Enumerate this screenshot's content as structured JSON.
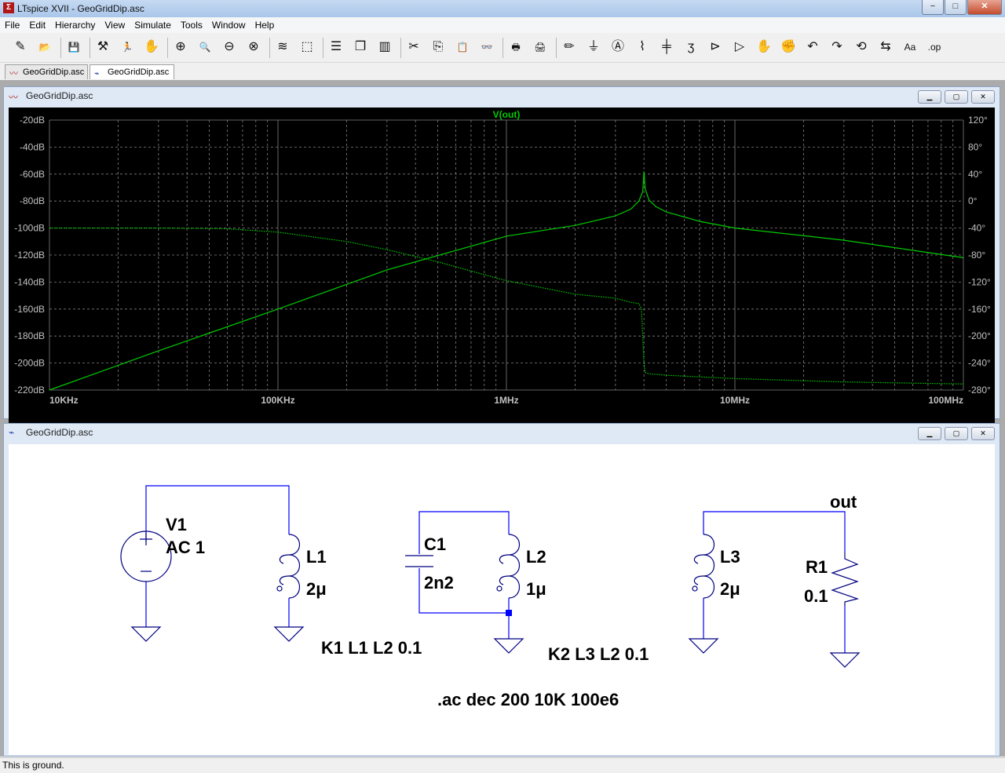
{
  "window": {
    "title": "LTspice XVII - GeoGridDip.asc",
    "min": "−",
    "max": "□",
    "close": "✕"
  },
  "menu": [
    "File",
    "Edit",
    "Hierarchy",
    "View",
    "Simulate",
    "Tools",
    "Window",
    "Help"
  ],
  "toolbar_icons": [
    {
      "name": "new-schematic-icon",
      "glyph": "✎"
    },
    {
      "name": "open-icon",
      "glyph": "📂"
    },
    {
      "name": "save-icon",
      "glyph": "💾"
    },
    {
      "name": "control-panel-icon",
      "glyph": "⚒"
    },
    {
      "name": "run-icon",
      "glyph": "🏃"
    },
    {
      "name": "halt-icon",
      "glyph": "✋"
    },
    {
      "name": "zoom-in-icon",
      "glyph": "⊕"
    },
    {
      "name": "pan-icon",
      "glyph": "🔍"
    },
    {
      "name": "zoom-out-icon",
      "glyph": "⊖"
    },
    {
      "name": "zoom-cancel-icon",
      "glyph": "⊗"
    },
    {
      "name": "autorange-icon",
      "glyph": "≋"
    },
    {
      "name": "fit-icon",
      "glyph": "⬚"
    },
    {
      "name": "tile-horizontal-icon",
      "glyph": "☰"
    },
    {
      "name": "cascade-icon",
      "glyph": "❐"
    },
    {
      "name": "tile-vertical-icon",
      "glyph": "▥"
    },
    {
      "name": "cut-icon",
      "glyph": "✂"
    },
    {
      "name": "copy-icon",
      "glyph": "⎘"
    },
    {
      "name": "paste-icon",
      "glyph": "📋"
    },
    {
      "name": "find-icon",
      "glyph": "👓"
    },
    {
      "name": "print-icon",
      "glyph": "🖶"
    },
    {
      "name": "print-setup-icon",
      "glyph": "🖨"
    },
    {
      "name": "draw-wire-icon",
      "glyph": "✏"
    },
    {
      "name": "ground-icon",
      "glyph": "⏚"
    },
    {
      "name": "label-net-icon",
      "glyph": "Ⓐ"
    },
    {
      "name": "resistor-icon",
      "glyph": "⌇"
    },
    {
      "name": "capacitor-icon",
      "glyph": "╪"
    },
    {
      "name": "inductor-icon",
      "glyph": "ʒ"
    },
    {
      "name": "diode-icon",
      "glyph": "⊳"
    },
    {
      "name": "component-icon",
      "glyph": "▷"
    },
    {
      "name": "move-icon",
      "glyph": "✋"
    },
    {
      "name": "drag-icon",
      "glyph": "✊"
    },
    {
      "name": "undo-icon",
      "glyph": "↶"
    },
    {
      "name": "redo-icon",
      "glyph": "↷"
    },
    {
      "name": "rotate-icon",
      "glyph": "⟲"
    },
    {
      "name": "mirror-icon",
      "glyph": "⇆"
    },
    {
      "name": "text-icon",
      "glyph": "Aa"
    },
    {
      "name": "spice-directive-icon",
      "glyph": ".op"
    }
  ],
  "doc_tabs": [
    {
      "label": "GeoGridDip.asc",
      "icon": "waveform-icon",
      "active": false
    },
    {
      "label": "GeoGridDip.asc",
      "icon": "schematic-icon",
      "active": true
    }
  ],
  "waveform_window": {
    "title": "GeoGridDip.asc"
  },
  "schematic_window": {
    "title": "GeoGridDip.asc"
  },
  "chart_data": {
    "type": "line",
    "title": "V(out)",
    "x_scale": "log",
    "x_ticks": [
      "10KHz",
      "100KHz",
      "1MHz",
      "10MHz",
      "100MHz"
    ],
    "x_range": [
      10000,
      100000000
    ],
    "y_left_ticks": [
      "-20dB",
      "-40dB",
      "-60dB",
      "-80dB",
      "-100dB",
      "-120dB",
      "-140dB",
      "-160dB",
      "-180dB",
      "-200dB",
      "-220dB"
    ],
    "y_left_range": [
      -220,
      -20
    ],
    "y_right_ticks": [
      "120°",
      "80°",
      "40°",
      "0°",
      "-40°",
      "-80°",
      "-120°",
      "-160°",
      "-200°",
      "-240°",
      "-280°"
    ],
    "y_right_range": [
      -280,
      120
    ],
    "grid": true,
    "colors": {
      "background": "#000000",
      "trace": "#00cc00",
      "grid": "#808080",
      "axis_text": "#c0c0c0"
    },
    "series": [
      {
        "name": "V(out)",
        "style": "solid",
        "unit": "dB",
        "x": [
          10000,
          30000,
          100000,
          300000,
          1000000,
          2000000,
          3000000,
          3500000,
          3800000,
          3950000,
          4000000,
          4050000,
          4200000,
          4500000,
          5000000,
          7000000,
          10000000,
          30000000,
          100000000
        ],
        "y": [
          -220,
          -191,
          -160,
          -131,
          -106,
          -98,
          -91,
          -86,
          -80,
          -73,
          -58,
          -71,
          -79,
          -84,
          -88,
          -95,
          -100,
          -109,
          -122
        ]
      },
      {
        "name": "V(out) phase",
        "style": "dotted",
        "unit": "deg",
        "x": [
          10000,
          30000,
          60000,
          100000,
          200000,
          300000,
          500000,
          1000000,
          2000000,
          3000000,
          3500000,
          3800000,
          3900000,
          3950000,
          4000000,
          4050000,
          4200000,
          5000000,
          10000000,
          30000000,
          100000000
        ],
        "y": [
          -40,
          -40,
          -41,
          -46,
          -60,
          -72,
          -90,
          -118,
          -138,
          -144,
          -150,
          -152,
          -160,
          -200,
          -240,
          -254,
          -256,
          -258,
          -263,
          -268,
          -271
        ]
      }
    ]
  },
  "schematic": {
    "v1_name": "V1",
    "v1_value": "AC 1",
    "l1_name": "L1",
    "l1_value": "2μ",
    "c1_name": "C1",
    "c1_value": "2n2",
    "l2_name": "L2",
    "l2_value": "1μ",
    "l3_name": "L3",
    "l3_value": "2μ",
    "r1_name": "R1",
    "r1_value": "0.1",
    "net_label": "out",
    "k1": "K1 L1 L2 0.1",
    "k2": "K2 L3 L2 0.1",
    "ac_directive": ".ac dec 200 10K 100e6",
    "colors": {
      "wire": "#0000ff",
      "component": "#000080",
      "text": "#000000"
    }
  },
  "status_text": "This is ground."
}
